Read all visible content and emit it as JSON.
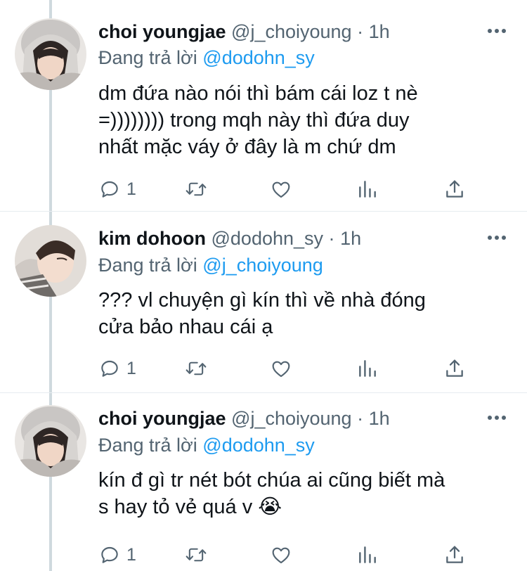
{
  "colors": {
    "text": "#0f1419",
    "muted": "#536471",
    "link": "#1d9bf0",
    "thread_line": "#cfd9de",
    "divider": "#e7ecf0"
  },
  "reply_prefix": "Đang trả lời",
  "separator": "·",
  "action_icons": [
    "reply-icon",
    "retweet-icon",
    "like-icon",
    "analytics-icon",
    "share-icon"
  ],
  "tweets": [
    {
      "name": "choi youngjae",
      "handle": "@j_choiyoung",
      "time": "1h",
      "reply_to": "@dodohn_sy",
      "lines": [
        "dm đứa nào nói thì bám cái loz t nè",
        "=)))))))) trong mqh này thì đứa duy",
        "nhất mặc váy ở đây là m chứ dm"
      ],
      "reply_count": "1"
    },
    {
      "name": "kim dohoon",
      "handle": "@dodohn_sy",
      "time": "1h",
      "reply_to": "@j_choiyoung",
      "lines": [
        "??? vl chuyện gì kín thì về nhà đóng",
        "cửa bảo nhau cái ạ"
      ],
      "reply_count": "1"
    },
    {
      "name": "choi youngjae",
      "handle": "@j_choiyoung",
      "time": "1h",
      "reply_to": "@dodohn_sy",
      "lines": [
        "kín đ gì tr nét bót chúa ai cũng biết mà",
        "s hay tỏ vẻ quá v 😭"
      ],
      "reply_count": "1"
    }
  ]
}
